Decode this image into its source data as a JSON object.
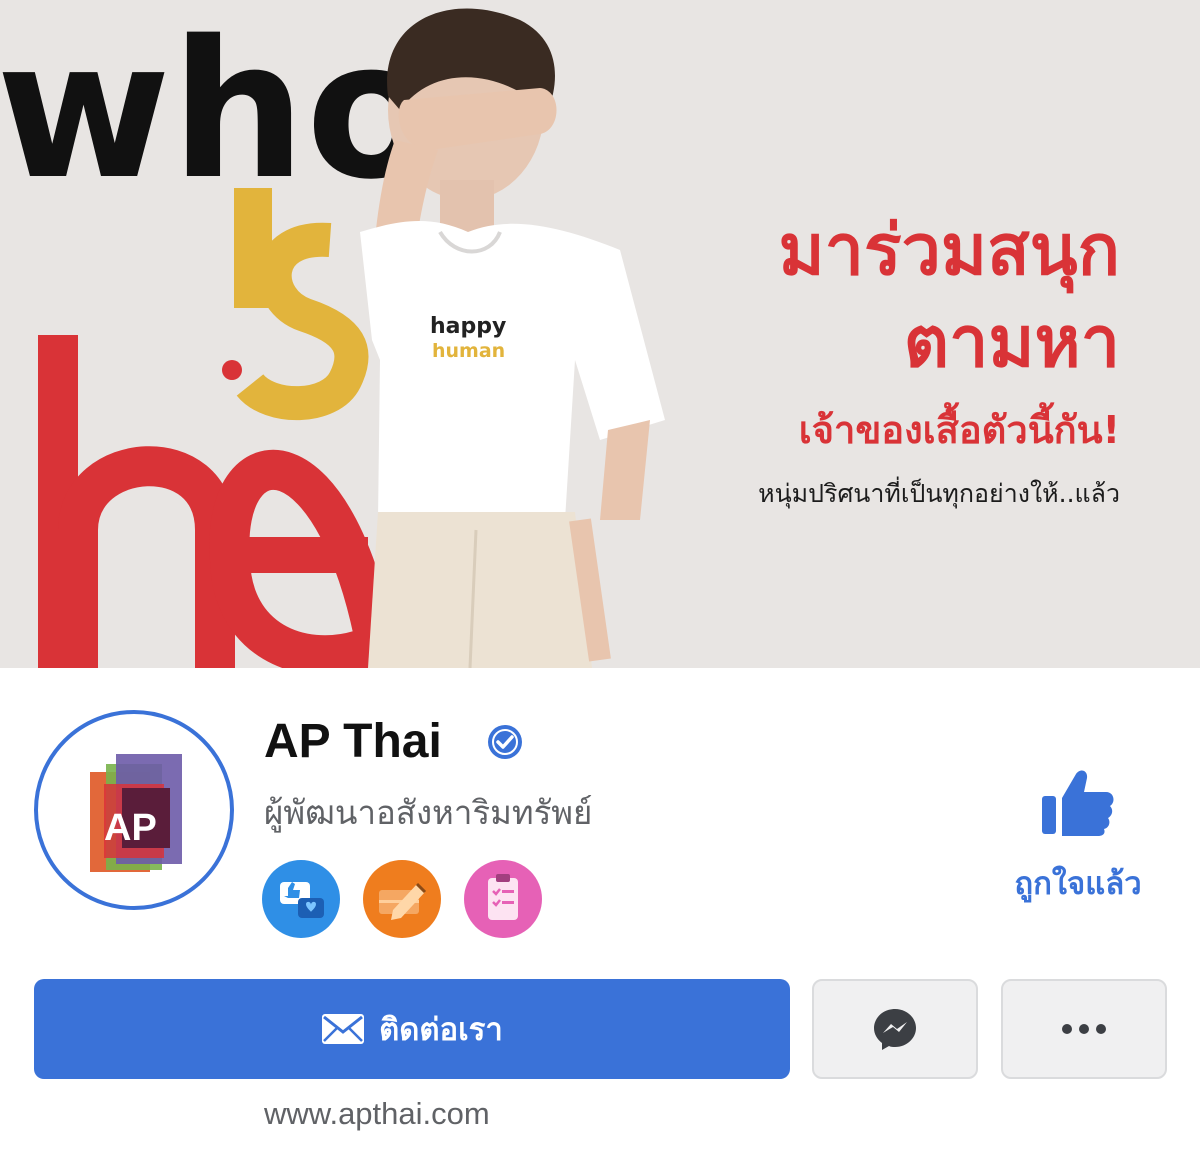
{
  "cover": {
    "art_words": [
      "who",
      "is",
      "he"
    ],
    "headline_1": "มาร่วมสนุก",
    "headline_2": "ตามหา",
    "headline_3": "เจ้าของเสื้อตัวนี้กัน!",
    "subline": "หนุ่มปริศนาที่เป็นทุกอย่างให้..แล้ว",
    "tshirt_print": [
      "happy",
      "human"
    ],
    "colors": {
      "background": "#e8e5e3",
      "black": "#111111",
      "yellow": "#e2b43c",
      "red": "#d93337"
    }
  },
  "profile": {
    "avatar_text": "AP",
    "name": "AP Thai",
    "verified_icon": "verified-badge-icon",
    "category": "ผู้พัฒนาอสังหาริมทรัพย์",
    "badges": [
      {
        "icon": "community-engagement-icon",
        "color": "#2f8fe6"
      },
      {
        "icon": "content-creator-icon",
        "color": "#ef7d1e"
      },
      {
        "icon": "checklist-icon",
        "color": "#e661b6"
      }
    ]
  },
  "like": {
    "icon": "thumbs-up-icon",
    "label": "ถูกใจแล้ว"
  },
  "actions": {
    "contact_label": "ติดต่อเรา",
    "contact_icon": "envelope-icon",
    "messenger_icon": "messenger-icon",
    "more_icon": "more-dots-icon"
  },
  "website": "www.apthai.com",
  "theme": {
    "accent": "#3a72d8",
    "secondary_text": "#606266"
  }
}
